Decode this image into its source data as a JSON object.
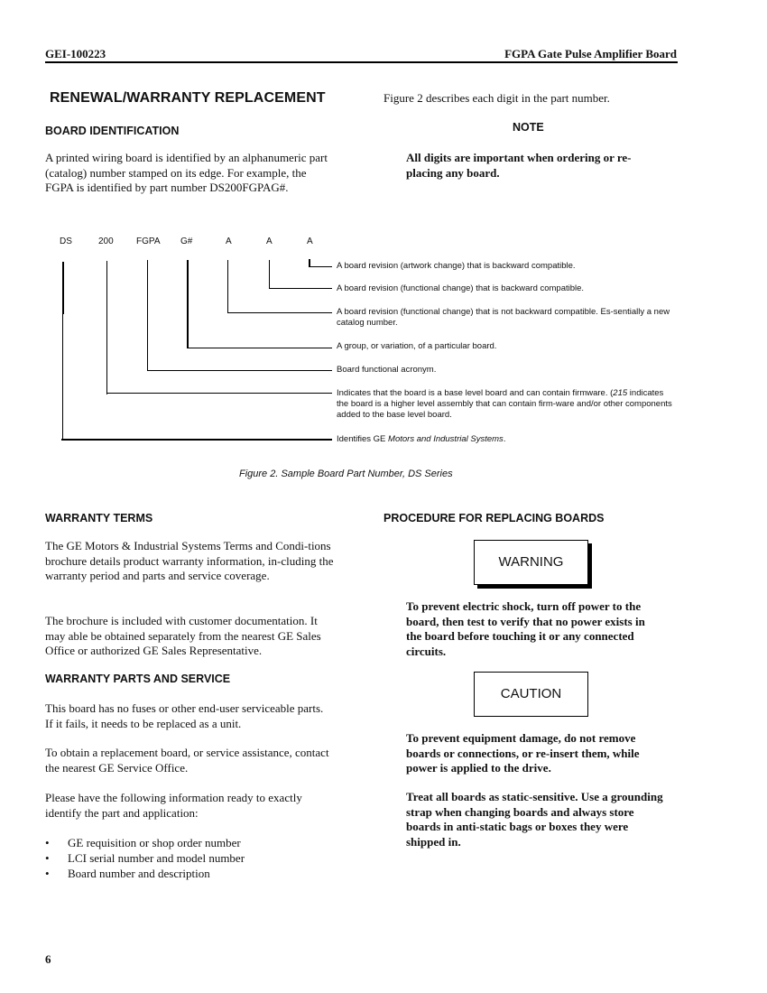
{
  "header": {
    "doc_id": "GEI-100223",
    "doc_title": "FGPA Gate Pulse Amplifier Board"
  },
  "renewal": {
    "title": "RENEWAL/WARRANTY REPLACEMENT",
    "board_identification": {
      "heading": "BOARD IDENTIFICATION",
      "paragraph": "A printed wiring board is identified by an alphanumeric part (catalog) number stamped on its edge.  For example, the FGPA is identified by part number DS200FGPAG#."
    },
    "figure_intro": "Figure 2 describes each digit in the part number.",
    "note": {
      "title": "NOTE",
      "text": "All digits are important when ordering or re-placing any board."
    }
  },
  "figure": {
    "segments": [
      "DS",
      "200",
      "FGPA",
      "G#",
      "A",
      "A",
      "A"
    ],
    "descriptions": [
      "A board revision (artwork change) that is backward compatible.",
      "A board revision (functional change) that is backward compatible.",
      "A board revision (functional change) that is not backward compatible. Es-sentially a new catalog number.",
      "A group, or variation, of a particular board.",
      "Board functional acronym.",
      "Indicates that the board is a base level board and can contain firmware.",
      "Identifies GE "
    ],
    "desc_200_extra_italic": "215",
    "desc_200_extra_rest": " indicates the board is a higher level assembly that can contain firm-ware and/or other components added to the base level board.",
    "desc_ds_italic": "Motors and Industrial Systems",
    "desc_ds_end": ".",
    "caption": "Figure 2. Sample Board Part Number, DS Series"
  },
  "warranty_terms": {
    "heading": "WARRANTY TERMS",
    "paragraphs": [
      "The GE Motors & Industrial Systems Terms and Condi-tions brochure details product warranty information, in-cluding the warranty period and parts and service coverage.",
      "The brochure is included with customer documentation. It may able be obtained separately from the nearest GE Sales Office or authorized GE Sales Representative."
    ]
  },
  "warranty_parts": {
    "heading": "WARRANTY PARTS AND SERVICE",
    "paragraphs": [
      "This board has no fuses or other end-user serviceable parts. If it fails, it needs to be replaced as a unit.",
      "To obtain a replacement board, or service assistance, contact the nearest GE Service Office.",
      "Please have the following information ready to exactly identify the part and application:"
    ],
    "bullets": [
      "GE requisition or shop order number",
      "LCI serial number and model number",
      "Board number and description"
    ]
  },
  "procedure": {
    "heading": "PROCEDURE FOR REPLACING BOARDS",
    "warning_label": "WARNING",
    "warning_text": "To prevent electric shock, turn off power to the board, then test to verify that no power exists in the board before touching it or any connected circuits.",
    "caution_label": "CAUTION",
    "caution_paragraphs": [
      "To prevent equipment damage, do not remove boards or connections, or re-insert them, while power is applied to the drive.",
      "Treat all boards as static-sensitive. Use a grounding strap when changing boards and always store boards in anti-static bags or boxes they were shipped in."
    ]
  },
  "footer": {
    "page_number": "6"
  }
}
